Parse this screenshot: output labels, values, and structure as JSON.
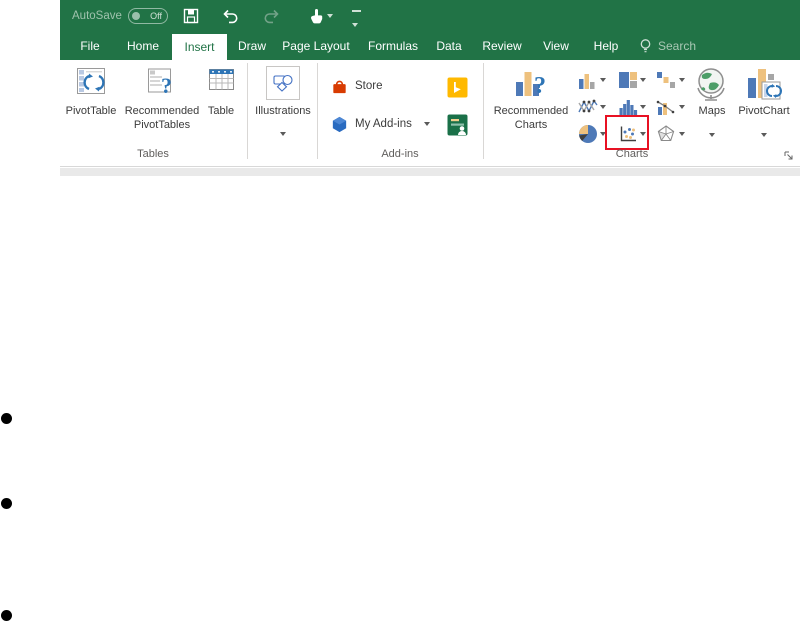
{
  "titlebar": {
    "autosave_label": "AutoSave",
    "autosave_state": "Off"
  },
  "tabs": [
    {
      "label": "File"
    },
    {
      "label": "Home"
    },
    {
      "label": "Insert",
      "active": true
    },
    {
      "label": "Draw"
    },
    {
      "label": "Page Layout"
    },
    {
      "label": "Formulas"
    },
    {
      "label": "Data"
    },
    {
      "label": "Review"
    },
    {
      "label": "View"
    },
    {
      "label": "Help"
    }
  ],
  "search": {
    "label": "Search"
  },
  "ribbon": {
    "tables": {
      "group_label": "Tables",
      "pivottable_label": "PivotTable",
      "recommended_line1": "Recommended",
      "recommended_line2": "PivotTables",
      "table_label": "Table"
    },
    "illustrations": {
      "button_label": "Illustrations"
    },
    "addins": {
      "group_label": "Add-ins",
      "store_label": "Store",
      "my_addins_label": "My Add-ins"
    },
    "charts": {
      "group_label": "Charts",
      "recommended_line1": "Recommended",
      "recommended_line2": "Charts",
      "maps_label": "Maps",
      "pivotchart_label": "PivotChart",
      "small_buttons": [
        "column-chart",
        "treemap-chart",
        "waterfall-chart",
        "line-stock-chart",
        "histogram-chart",
        "combo-chart",
        "pie-chart",
        "scatter-chart",
        "radar-chart"
      ],
      "highlighted_button": "scatter-chart"
    }
  },
  "page": {
    "bullet_count": 3
  },
  "icons": {
    "quick_access": [
      "save-icon",
      "undo-icon",
      "redo-icon",
      "touch-mode-icon",
      "customize-toolbar-icon"
    ],
    "search": "lightbulb-icon",
    "addins": [
      "store-bag-icon",
      "my-addins-hexagon-icon",
      "bing-icon",
      "people-graph-icon"
    ],
    "dialog_launcher": "charts-dialog-launcher-icon"
  },
  "colors": {
    "excel_green": "#217346",
    "chart_blue": "#4e79b7",
    "chart_tan": "#eec17e",
    "chart_gray": "#a6a6a6",
    "highlight_red": "#e81123",
    "store_orange": "#d83b01",
    "addin_blue": "#2a6bc0",
    "bing_yellow": "#ffb900",
    "people_graph_green": "#1a7048"
  }
}
